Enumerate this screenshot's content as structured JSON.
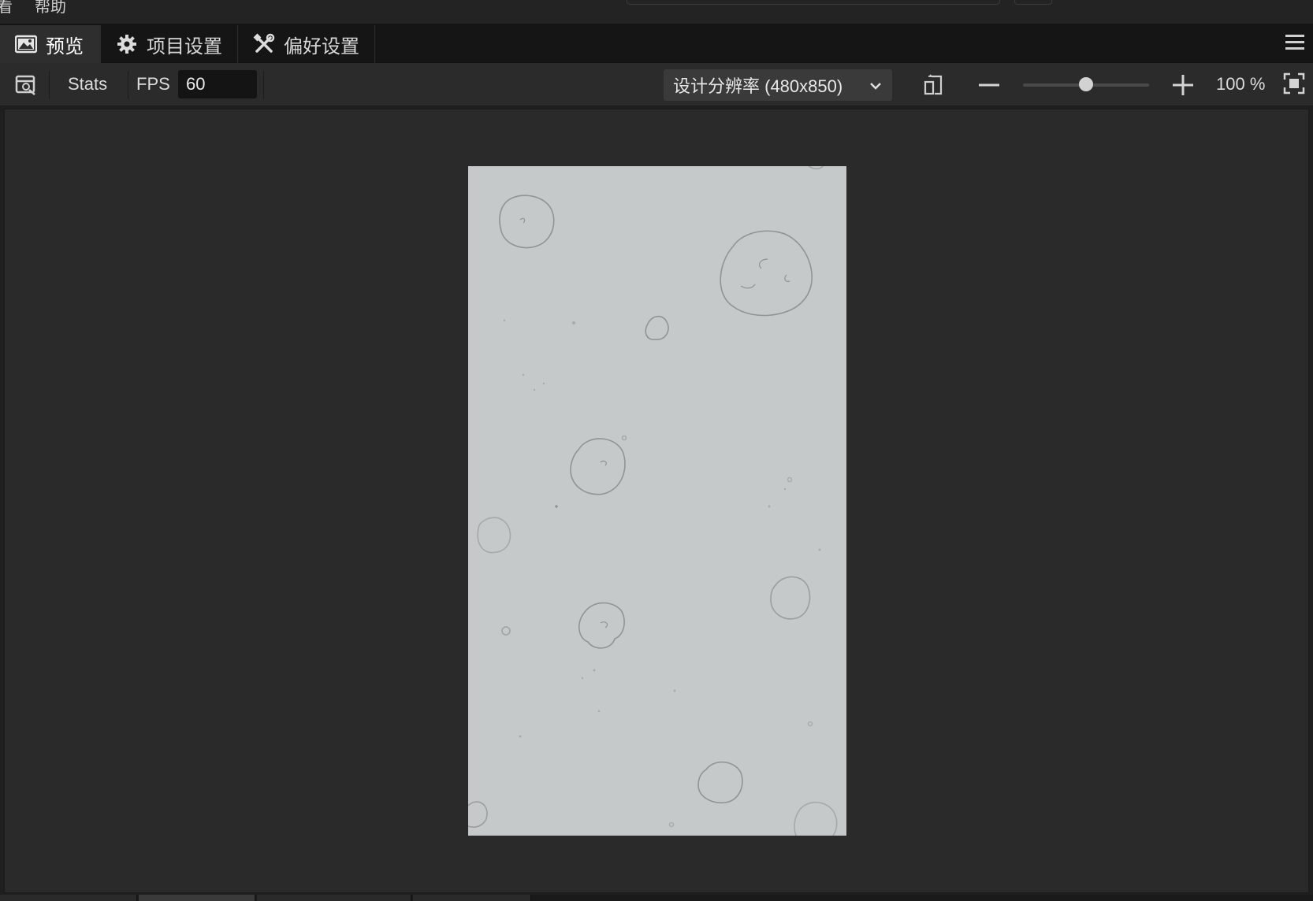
{
  "menubar": {
    "items": [
      "看",
      "帮助"
    ]
  },
  "tabs": [
    {
      "label": "预览",
      "icon": "image-icon",
      "active": true
    },
    {
      "label": "项目设置",
      "icon": "gear-icon",
      "active": false
    },
    {
      "label": "偏好设置",
      "icon": "tools-icon",
      "active": false
    }
  ],
  "toolbar": {
    "stats_label": "Stats",
    "fps_label": "FPS",
    "fps_value": "60",
    "resolution_label": "设计分辨率 (480x850)",
    "zoom_level": 0.5,
    "zoom_text": "100 %"
  },
  "canvas": {
    "background": "#c6c9c9",
    "content": "asteroid-field-background"
  },
  "colors": {
    "panel": "#2b2b2b",
    "tabbar": "#151515",
    "active_tab": "#2e2e2e",
    "canvas_bg": "#c6c9c9",
    "asteroid_stroke": "#8f9494"
  }
}
